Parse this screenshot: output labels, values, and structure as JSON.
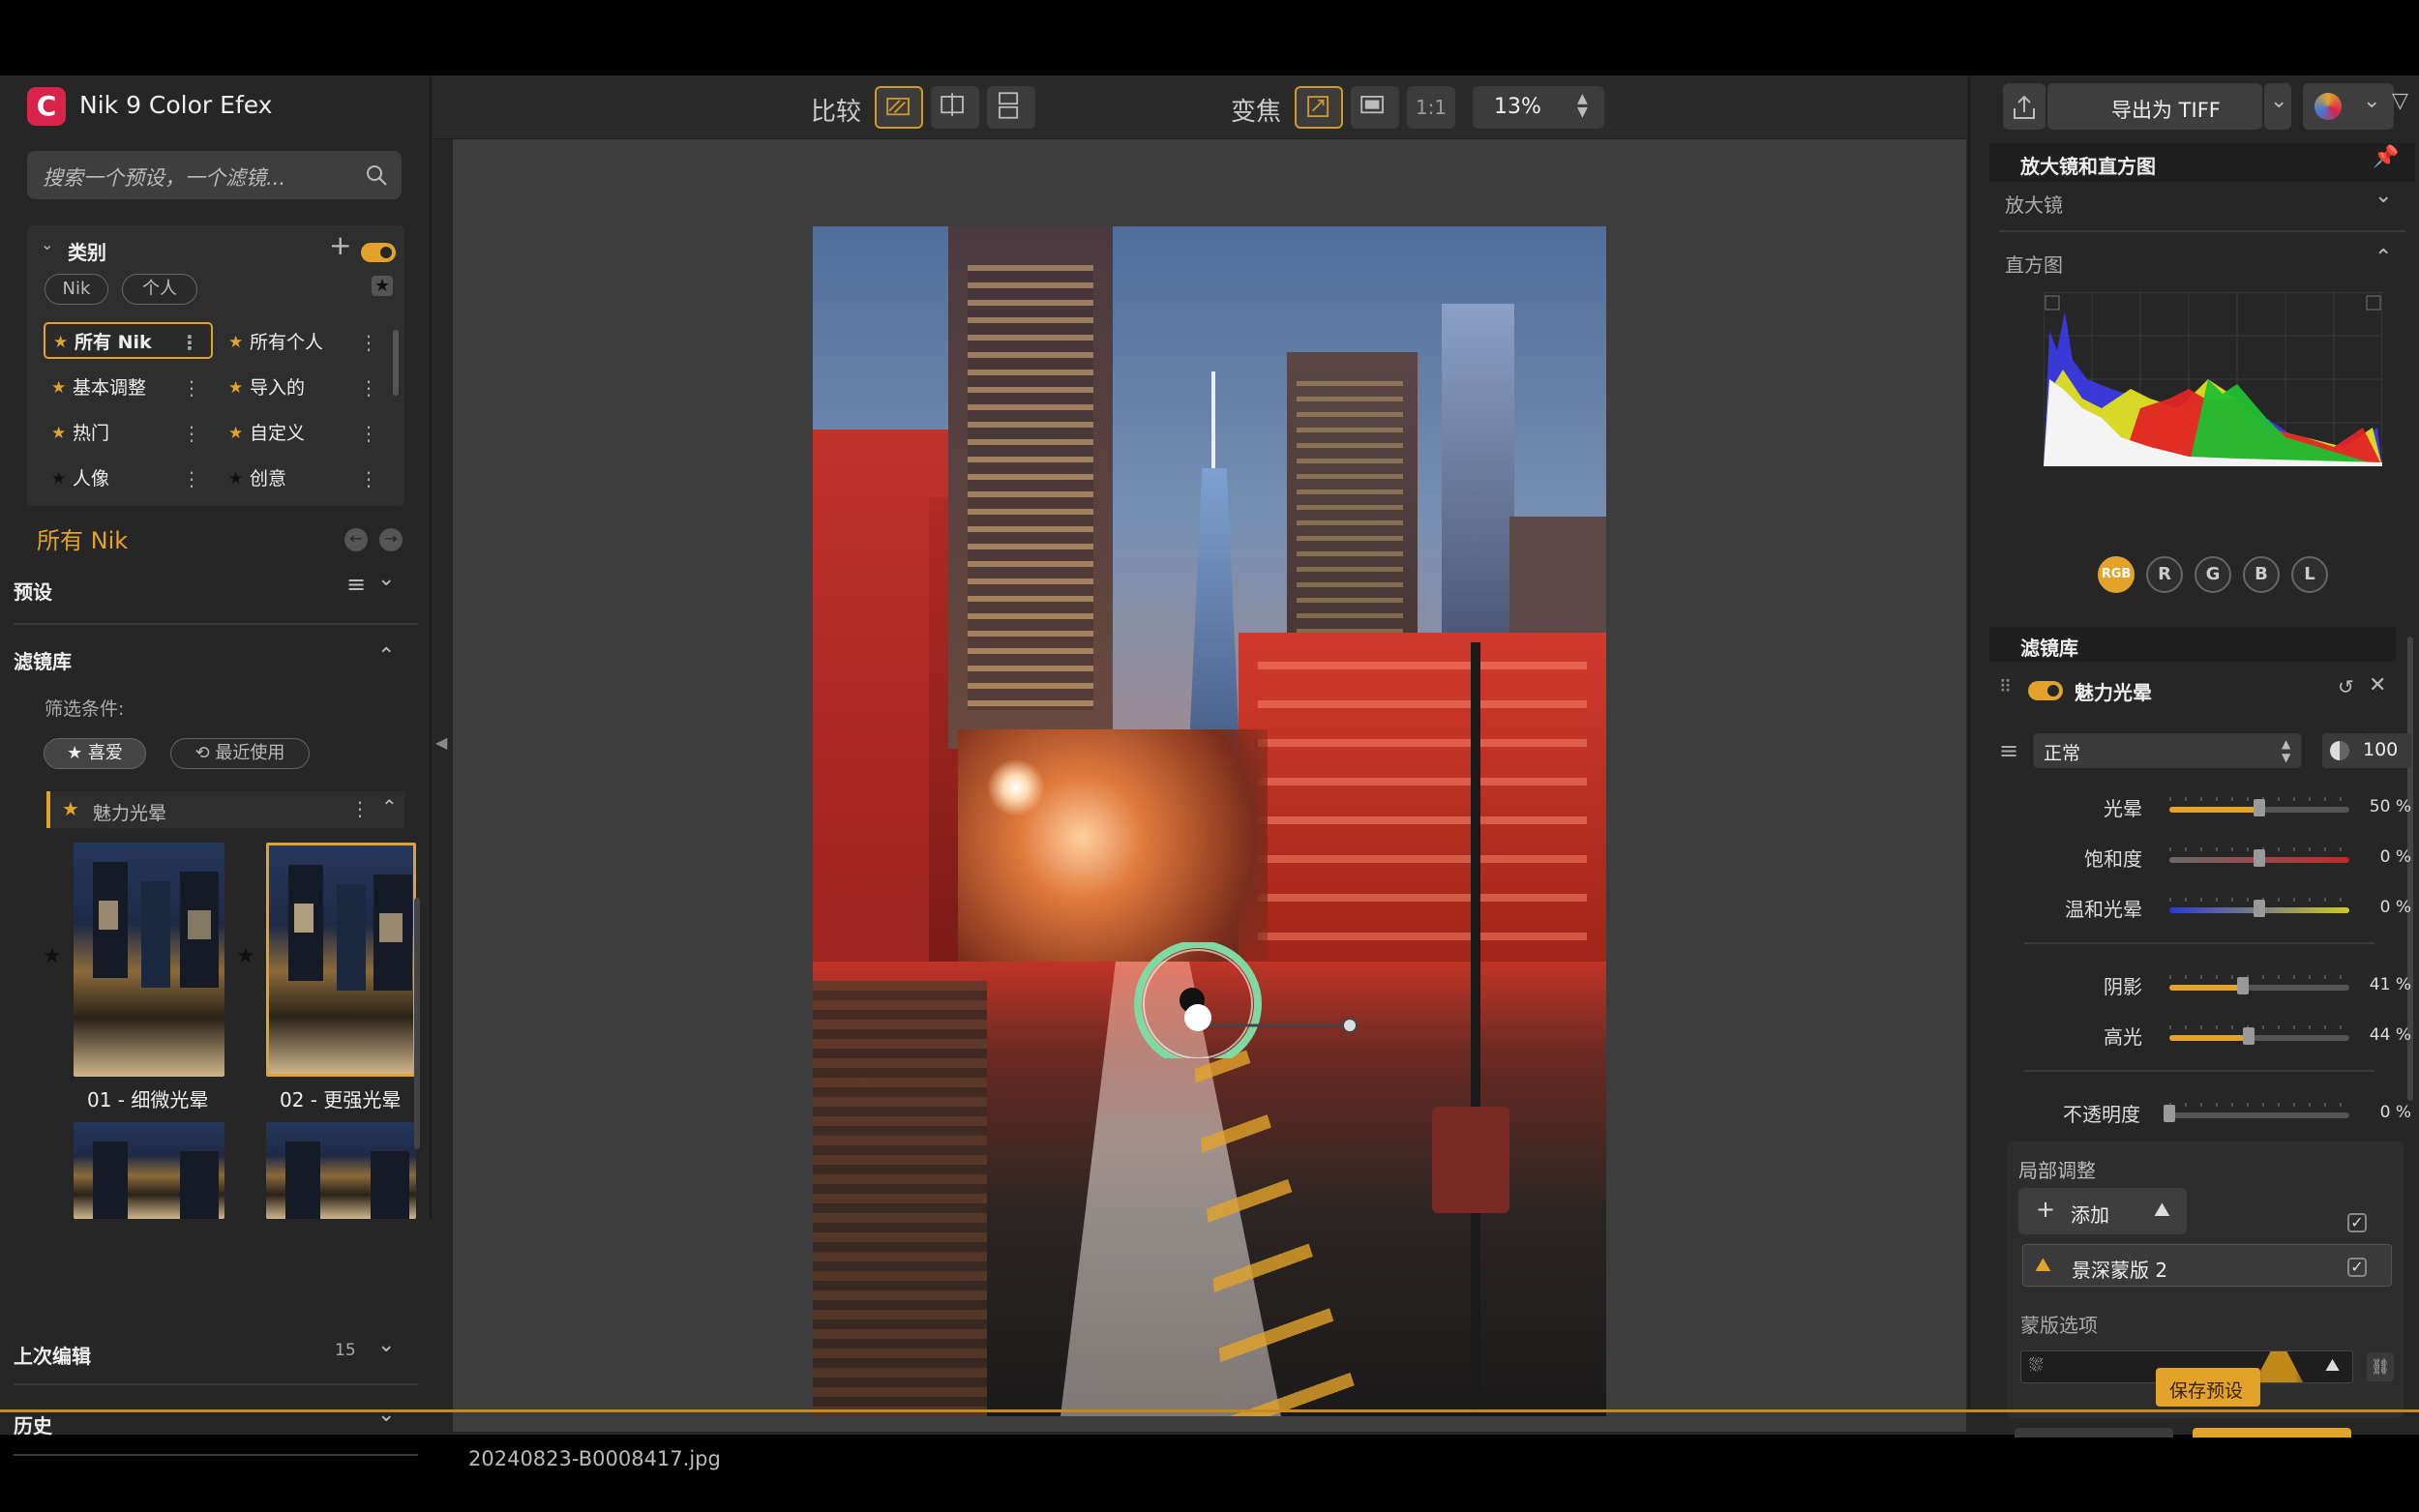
{
  "app": {
    "title": "Nik 9 Color Efex",
    "logo_letter": "C"
  },
  "search": {
    "placeholder": "搜索一个预设，一个滤镜..."
  },
  "categories": {
    "label": "类别",
    "tags": [
      "Nik",
      "个人"
    ],
    "items": [
      {
        "label": "所有 Nik",
        "selected": true,
        "star": "gold"
      },
      {
        "label": "所有个人",
        "star": "gold"
      },
      {
        "label": "基本调整",
        "star": "gold"
      },
      {
        "label": "导入的",
        "star": "gold"
      },
      {
        "label": "热门",
        "star": "gold"
      },
      {
        "label": "自定义",
        "star": "gold"
      },
      {
        "label": "人像",
        "star": "dark"
      },
      {
        "label": "创意",
        "star": "dark"
      }
    ],
    "current": "所有 Nik"
  },
  "presets": {
    "label": "预设"
  },
  "filter_lib": {
    "label": "滤镜库",
    "filter_by": "筛选条件:",
    "favorites": "喜爱",
    "recent": "最近使用",
    "group": "魅力光晕",
    "thumbs": [
      {
        "label": "01 - 细微光晕"
      },
      {
        "label": "02 - 更强光晕",
        "selected": true
      }
    ]
  },
  "last_edit": {
    "label": "上次编辑",
    "count": "15"
  },
  "history": {
    "label": "历史"
  },
  "toolbar": {
    "compare": "比较",
    "zoom": "变焦",
    "one_to_one": "1:1",
    "zoom_value": "13%",
    "export": "导出为 TIFF"
  },
  "file": {
    "name": "20240823-B0008417.jpg"
  },
  "right": {
    "loupe_hist": "放大镜和直方图",
    "loupe": "放大镜",
    "histogram": "直方图",
    "channels": [
      "RGB",
      "R",
      "G",
      "B",
      "L"
    ],
    "filter_lib": "滤镜库",
    "filter_name": "魅力光晕",
    "blend_mode": "正常",
    "opacity_value": "100",
    "sliders": [
      {
        "label": "光晕",
        "value": "50 %",
        "level": 0.5
      },
      {
        "label": "饱和度",
        "value": "0 %",
        "level": 0.5
      },
      {
        "label": "温和光晕",
        "value": "0 %",
        "level": 0.5
      },
      {
        "label": "阴影",
        "value": "41 %",
        "level": 0.41
      },
      {
        "label": "高光",
        "value": "44 %",
        "level": 0.44
      },
      {
        "label": "不透明度",
        "value": "0 %",
        "level": 0.0
      }
    ],
    "local_adjust": "局部调整",
    "add": "添加",
    "mask_name": "景深蒙版 2",
    "mask_options": "蒙版选项",
    "save_preset": "保存预设"
  },
  "colors": {
    "accent": "#e3a32a",
    "logo": "#d8244a",
    "ring": "#7fd9a0"
  }
}
